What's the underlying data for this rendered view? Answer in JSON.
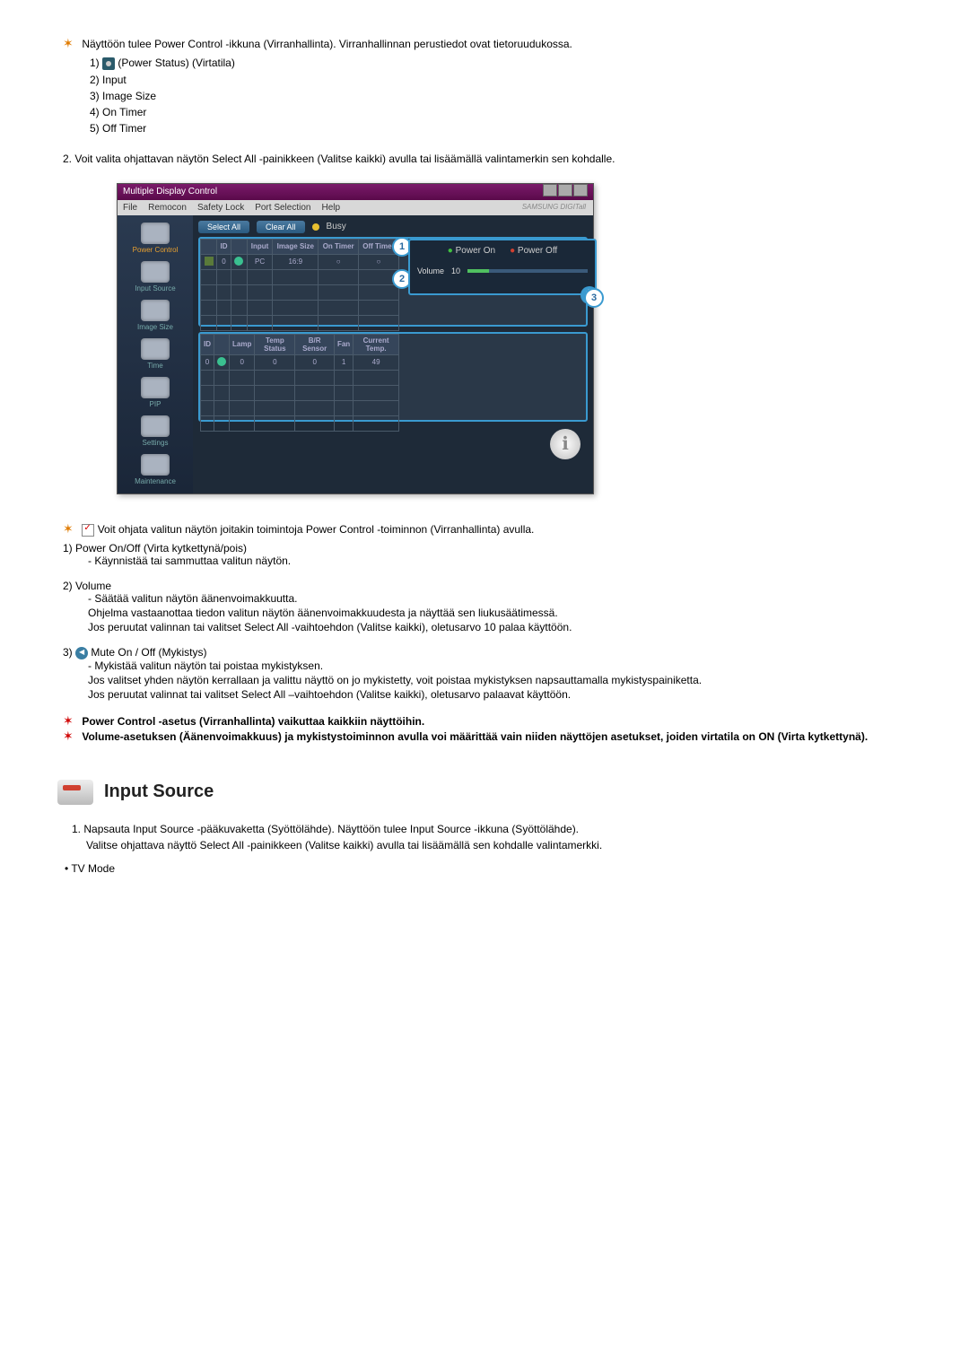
{
  "intro": {
    "line": "Näyttöön tulee Power Control -ikkuna (Virranhallinta). Virranhallinnan perustiedot ovat tietoruudukossa.",
    "items": [
      "(Power Status) (Virtatila)",
      "Input",
      "Image Size",
      "On Timer",
      "Off Timer"
    ],
    "num1_prefix": "1) ",
    "prefixes": [
      "2) ",
      "3) ",
      "4) ",
      "5) "
    ]
  },
  "para2_num": "2.",
  "para2": "Voit valita ohjattavan näytön Select All -painikkeen (Valitse kaikki) avulla tai lisäämällä valintamerkin sen kohdalle.",
  "app": {
    "title": "Multiple Display Control",
    "menu": [
      "File",
      "Remocon",
      "Safety Lock",
      "Port Selection",
      "Help"
    ],
    "brand": "SAMSUNG DIGITall",
    "sidebar": [
      {
        "label": "Power Control",
        "active": true
      },
      {
        "label": "Input Source"
      },
      {
        "label": "Image Size"
      },
      {
        "label": "Time"
      },
      {
        "label": "PIP"
      },
      {
        "label": "Settings"
      },
      {
        "label": "Maintenance"
      }
    ],
    "buttons": {
      "select_all": "Select All",
      "clear_all": "Clear All",
      "busy": "Busy"
    },
    "grid1_headers": [
      "",
      "ID",
      "",
      "Input",
      "Image Size",
      "On Timer",
      "Off Timer"
    ],
    "grid1_row": {
      "id": "0",
      "input": "PC",
      "size": "16:9"
    },
    "grid2_headers": [
      "ID",
      "",
      "Lamp",
      "Temp Status",
      "B/R Sensor",
      "Fan",
      "Current Temp."
    ],
    "grid2_row": {
      "id": "0",
      "lamp": "0",
      "temp": "0",
      "br": "0",
      "fan": "1",
      "ct": "49"
    },
    "right": {
      "power_on": "Power On",
      "power_off": "Power Off",
      "volume_label": "Volume",
      "volume_value": "10"
    },
    "callouts": [
      "1",
      "2",
      "3"
    ]
  },
  "below_shot": {
    "intro": "Voit ohjata valitun näytön joitakin toimintoja Power Control -toiminnon (Virranhallinta) avulla.",
    "items": [
      {
        "num": "1)",
        "title": "Power On/Off (Virta kytkettynä/pois)",
        "lines": [
          "- Käynnistää tai sammuttaa valitun näytön."
        ]
      },
      {
        "num": "2)",
        "title": "Volume",
        "lines": [
          "- Säätää valitun näytön äänenvoimakkuutta.",
          "Ohjelma vastaanottaa tiedon valitun näytön äänenvoimakkuudesta ja näyttää sen liukusäätimessä.",
          "Jos peruutat valinnan tai valitset Select All -vaihtoehdon (Valitse kaikki), oletusarvo 10 palaa käyttöön."
        ]
      },
      {
        "num": "3)",
        "title": "Mute On / Off (Mykistys)",
        "icon": true,
        "lines": [
          "- Mykistää valitun näytön tai poistaa mykistyksen.",
          "Jos valitset yhden näytön kerrallaan ja valittu näyttö on jo mykistetty, voit poistaa mykistyksen napsauttamalla mykistyspainiketta.",
          "Jos peruutat valinnat tai valitset Select All –vaihtoehdon (Valitse kaikki), oletusarvo palaavat käyttöön."
        ]
      }
    ],
    "notes": [
      "Power Control -asetus (Virranhallinta) vaikuttaa kaikkiin näyttöihin.",
      "Volume-asetuksen (Äänenvoimakkuus) ja mykistystoiminnon avulla voi määrittää vain niiden näyttöjen asetukset, joiden virtatila on ON (Virta kytkettynä)."
    ]
  },
  "section2": {
    "title": "Input Source",
    "ol_num": "1.",
    "ol": [
      "Napsauta Input Source -pääkuvaketta (Syöttölähde). Näyttöön tulee Input Source -ikkuna (Syöttölähde).",
      "Valitse ohjattava näyttö Select All -painikkeen (Valitse kaikki) avulla tai lisäämällä sen kohdalle valintamerkki."
    ],
    "bullet": "• TV Mode"
  }
}
